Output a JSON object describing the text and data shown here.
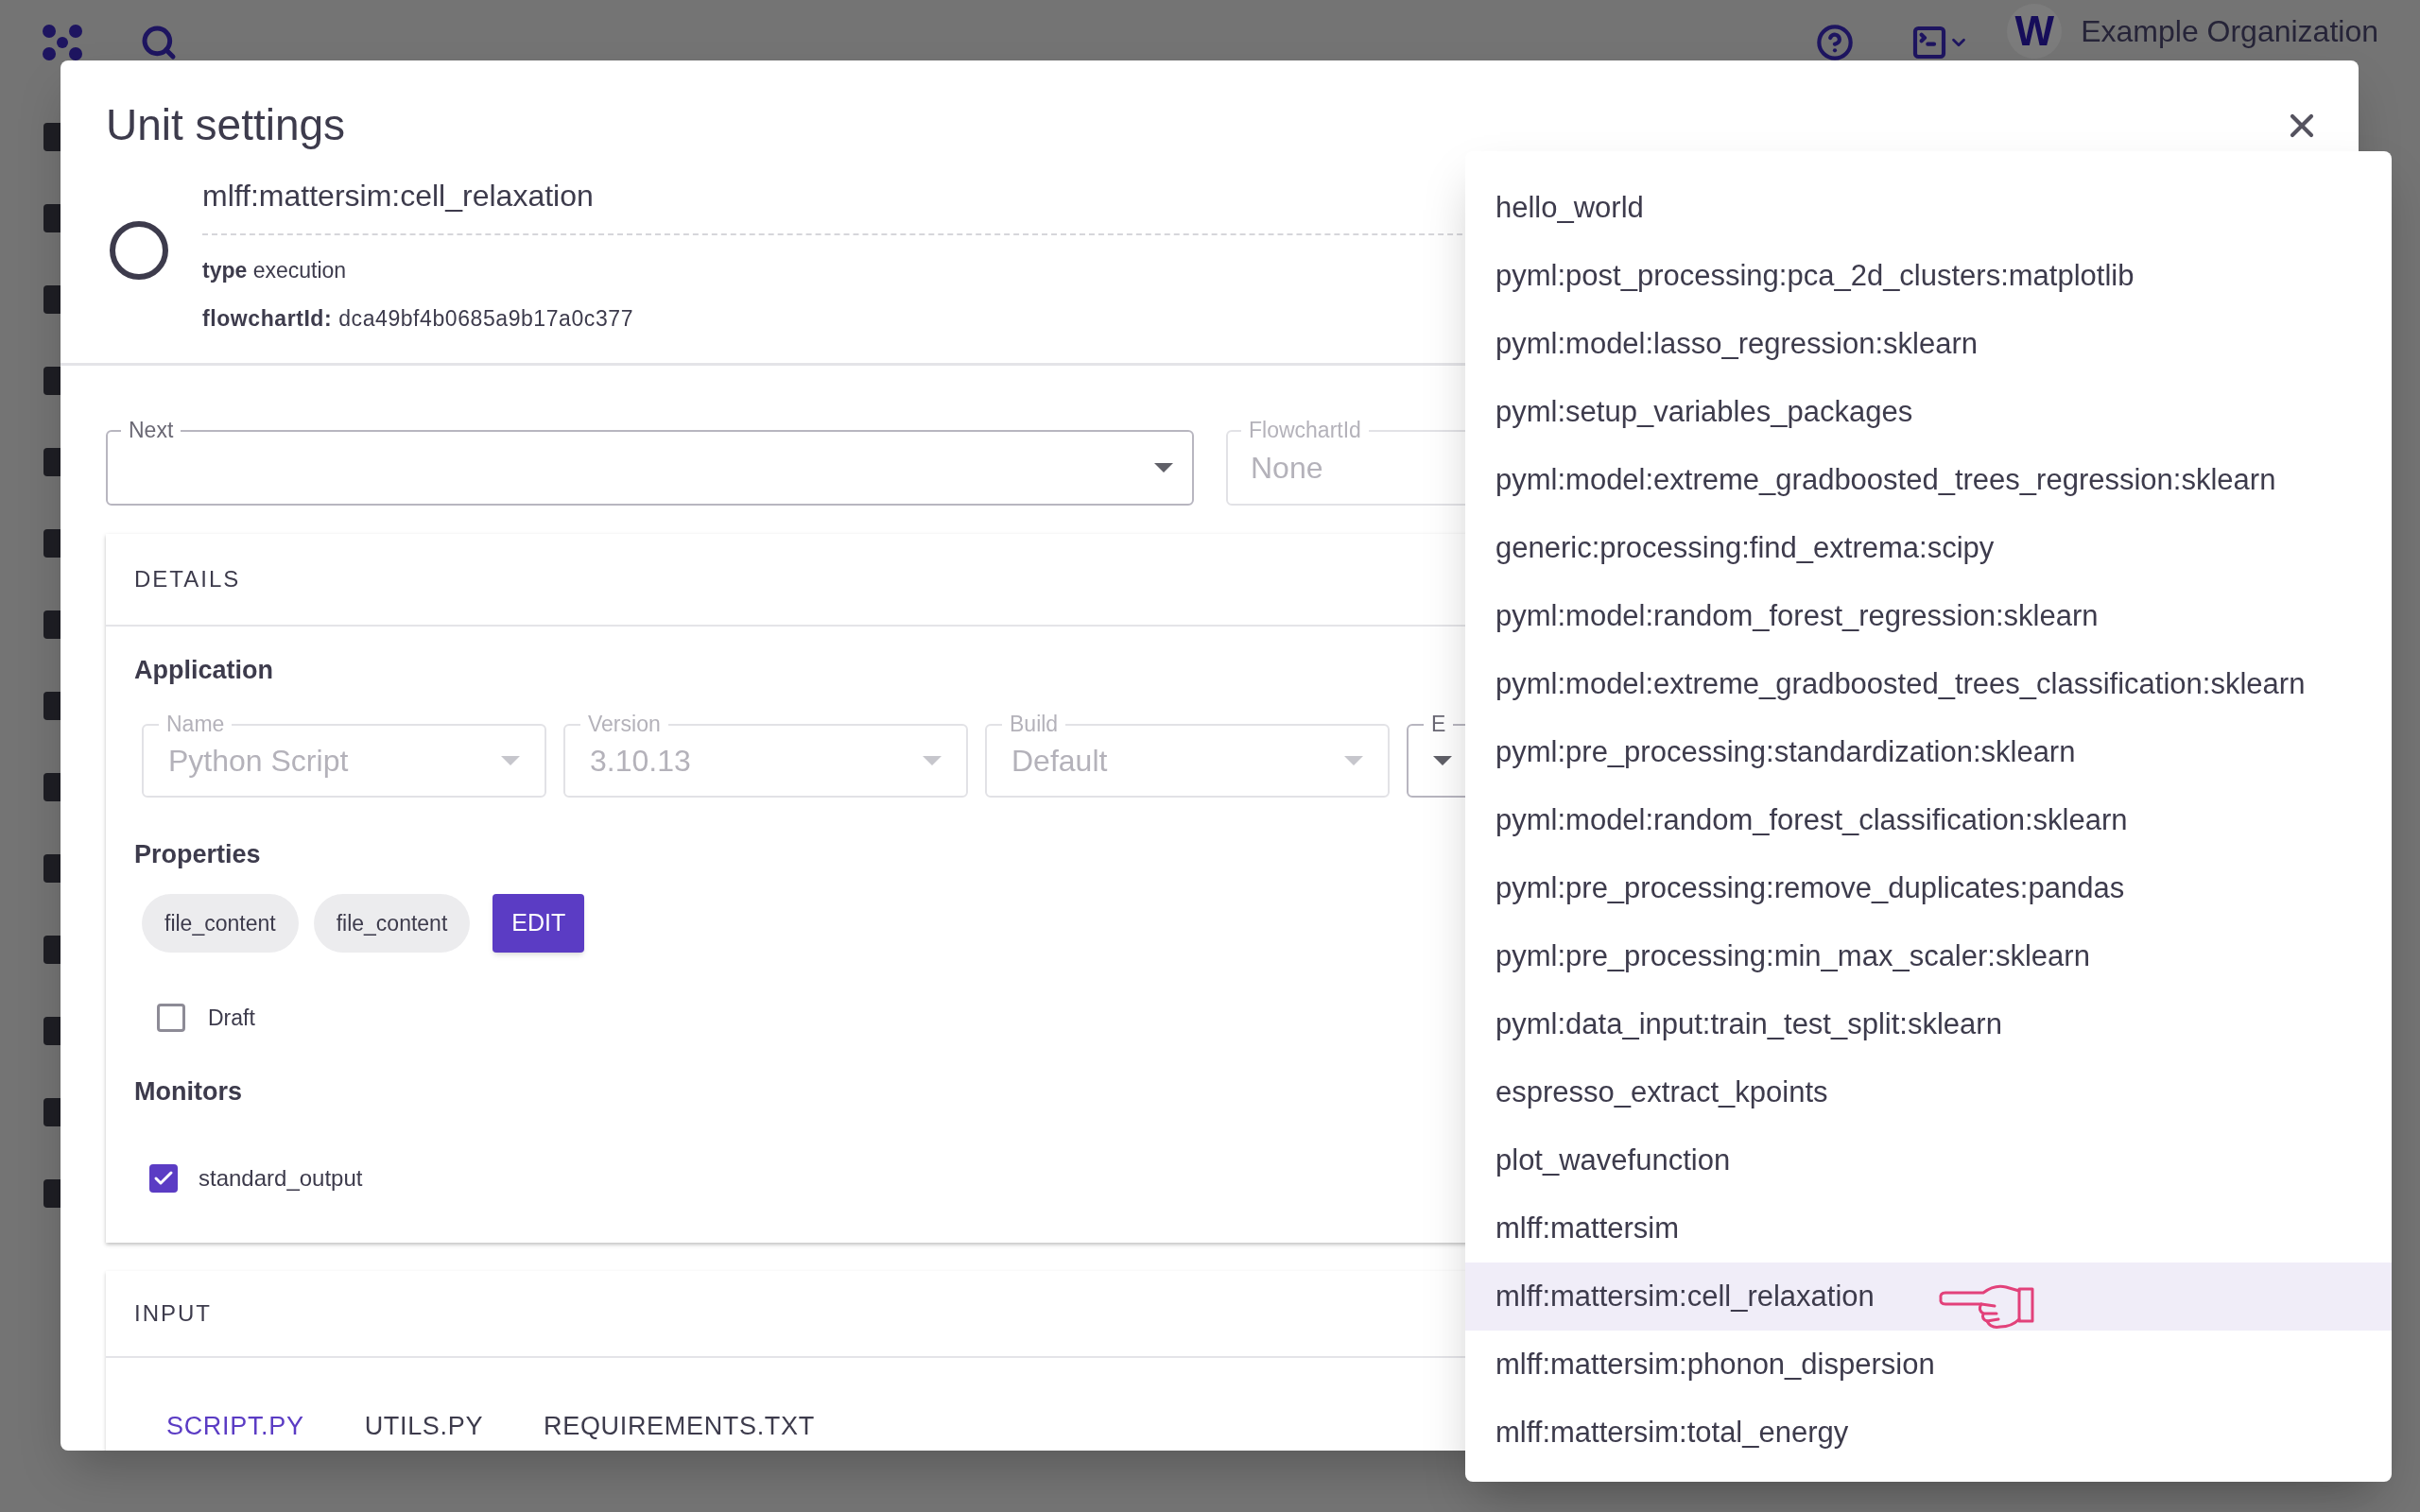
{
  "app_bar": {
    "avatar_letter": "W",
    "organization": "Example Organization"
  },
  "dialog": {
    "title": "Unit settings",
    "unit": {
      "name": "mlff:mattersim:cell_relaxation",
      "type_label": "type",
      "type": "execution",
      "flowchart_label": "flowchartId:",
      "flowchart_id": "dca49bf4b0685a9b17a0c377"
    },
    "next_field": {
      "label": "Next"
    },
    "flowchart_field": {
      "label": "FlowchartId",
      "value": "None",
      "disabled": true
    },
    "details": {
      "heading": "DETAILS",
      "application_heading": "Application",
      "application_fields": [
        {
          "label": "Name",
          "value": "Python Script",
          "disabled": true
        },
        {
          "label": "Version",
          "value": "3.10.13",
          "disabled": true
        },
        {
          "label": "Build",
          "value": "Default",
          "disabled": true
        },
        {
          "label": "E",
          "disabled": false
        }
      ],
      "properties_heading": "Properties",
      "properties": [
        "file_content",
        "file_content"
      ],
      "edit_button": "EDIT",
      "draft": {
        "label": "Draft",
        "checked": false
      },
      "monitors_heading": "Monitors",
      "monitors": [
        {
          "label": "standard_output",
          "checked": true
        }
      ]
    },
    "input": {
      "heading": "INPUT",
      "tabs": [
        {
          "label": "SCRIPT.PY",
          "selected": true
        },
        {
          "label": "UTILS.PY",
          "selected": false
        },
        {
          "label": "REQUIREMENTS.TXT",
          "selected": false
        }
      ]
    }
  },
  "dropdown": {
    "items": [
      {
        "label": "hello_world",
        "selected": false
      },
      {
        "label": "pyml:post_processing:pca_2d_clusters:matplotlib",
        "selected": false
      },
      {
        "label": "pyml:model:lasso_regression:sklearn",
        "selected": false
      },
      {
        "label": "pyml:setup_variables_packages",
        "selected": false
      },
      {
        "label": "pyml:model:extreme_gradboosted_trees_regression:sklearn",
        "selected": false
      },
      {
        "label": "generic:processing:find_extrema:scipy",
        "selected": false
      },
      {
        "label": "pyml:model:random_forest_regression:sklearn",
        "selected": false
      },
      {
        "label": "pyml:model:extreme_gradboosted_trees_classification:sklearn",
        "selected": false
      },
      {
        "label": "pyml:pre_processing:standardization:sklearn",
        "selected": false
      },
      {
        "label": "pyml:model:random_forest_classification:sklearn",
        "selected": false
      },
      {
        "label": "pyml:pre_processing:remove_duplicates:pandas",
        "selected": false
      },
      {
        "label": "pyml:pre_processing:min_max_scaler:sklearn",
        "selected": false
      },
      {
        "label": "pyml:data_input:train_test_split:sklearn",
        "selected": false
      },
      {
        "label": "espresso_extract_kpoints",
        "selected": false
      },
      {
        "label": "plot_wavefunction",
        "selected": false
      },
      {
        "label": "mlff:mattersim",
        "selected": false
      },
      {
        "label": "mlff:mattersim:cell_relaxation",
        "selected": true
      },
      {
        "label": "mlff:mattersim:phonon_dispersion",
        "selected": false
      },
      {
        "label": "mlff:mattersim:total_energy",
        "selected": false
      }
    ]
  }
}
